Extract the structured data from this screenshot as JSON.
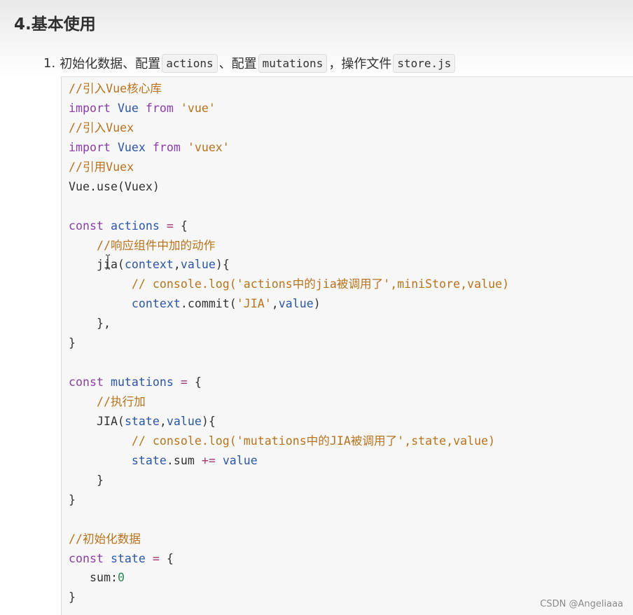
{
  "heading": "4.基本使用",
  "list_item": {
    "number": "1.",
    "text_1": "初始化数据、配置",
    "code_1": "actions",
    "text_2": "、配置",
    "code_2": "mutations",
    "text_3": "，操作文件",
    "code_3": "store.js"
  },
  "code_lines": [
    [
      [
        "comment",
        "//引入Vue核心库"
      ]
    ],
    [
      [
        "keyword",
        "import "
      ],
      [
        "ident",
        "Vue "
      ],
      [
        "keyword",
        "from "
      ],
      [
        "string",
        "'vue'"
      ]
    ],
    [
      [
        "comment",
        "//引入Vuex"
      ]
    ],
    [
      [
        "keyword",
        "import "
      ],
      [
        "ident",
        "Vuex "
      ],
      [
        "keyword",
        "from "
      ],
      [
        "string",
        "'vuex'"
      ]
    ],
    [
      [
        "comment",
        "//引用Vuex"
      ]
    ],
    [
      [
        "plain",
        "Vue.use(Vuex)"
      ]
    ],
    [],
    [
      [
        "keyword",
        "const "
      ],
      [
        "ident",
        "actions "
      ],
      [
        "op",
        "= "
      ],
      [
        "plain",
        "{"
      ]
    ],
    [
      [
        "plain",
        "    "
      ],
      [
        "comment",
        "//响应组件中加的动作"
      ]
    ],
    [
      [
        "plain",
        "    jia("
      ],
      [
        "ident",
        "context"
      ],
      [
        "plain",
        ","
      ],
      [
        "ident",
        "value"
      ],
      [
        "plain",
        "){"
      ]
    ],
    [
      [
        "plain",
        "         "
      ],
      [
        "comment",
        "// console.log('actions中的jia被调用了',miniStore,value)"
      ]
    ],
    [
      [
        "plain",
        "         "
      ],
      [
        "ident",
        "context"
      ],
      [
        "plain",
        ".commit("
      ],
      [
        "string",
        "'JIA'"
      ],
      [
        "plain",
        ","
      ],
      [
        "ident",
        "value"
      ],
      [
        "plain",
        ")"
      ]
    ],
    [
      [
        "plain",
        "    },"
      ]
    ],
    [
      [
        "plain",
        "}"
      ]
    ],
    [],
    [
      [
        "keyword",
        "const "
      ],
      [
        "ident",
        "mutations "
      ],
      [
        "op",
        "= "
      ],
      [
        "plain",
        "{"
      ]
    ],
    [
      [
        "plain",
        "    "
      ],
      [
        "comment",
        "//执行加"
      ]
    ],
    [
      [
        "plain",
        "    JIA("
      ],
      [
        "ident",
        "state"
      ],
      [
        "plain",
        ","
      ],
      [
        "ident",
        "value"
      ],
      [
        "plain",
        "){"
      ]
    ],
    [
      [
        "plain",
        "         "
      ],
      [
        "comment",
        "// console.log('mutations中的JIA被调用了',state,value)"
      ]
    ],
    [
      [
        "plain",
        "         "
      ],
      [
        "ident",
        "state"
      ],
      [
        "plain",
        ".sum "
      ],
      [
        "op",
        "+= "
      ],
      [
        "ident",
        "value"
      ]
    ],
    [
      [
        "plain",
        "    }"
      ]
    ],
    [
      [
        "plain",
        "}"
      ]
    ],
    [],
    [
      [
        "comment",
        "//初始化数据"
      ]
    ],
    [
      [
        "keyword",
        "const "
      ],
      [
        "ident",
        "state "
      ],
      [
        "op",
        "= "
      ],
      [
        "plain",
        "{"
      ]
    ],
    [
      [
        "plain",
        "   sum:"
      ],
      [
        "number",
        "0"
      ]
    ],
    [
      [
        "plain",
        "}"
      ]
    ]
  ],
  "watermark": "CSDN @Angeliaaa"
}
